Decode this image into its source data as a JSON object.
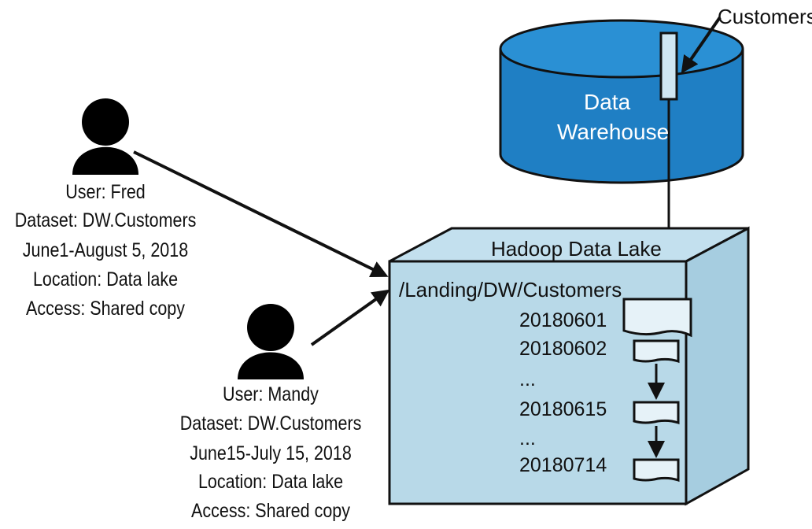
{
  "warehouse": {
    "title_line1": "Data",
    "title_line2": "Warehouse",
    "table_label": "Customers",
    "fill_color": "#1f7fc4"
  },
  "lake": {
    "title": "Hadoop Data Lake",
    "path": "/Landing/DW/Customers",
    "partitions": [
      "20180601",
      "20180602",
      "...",
      "20180615",
      "...",
      "20180714"
    ],
    "fill_color": "#b8d9e8"
  },
  "users": [
    {
      "user": "User: Fred",
      "dataset": "Dataset: DW.Customers",
      "range": "June1-August 5, 2018",
      "location": "Location: Data lake",
      "access": "Access: Shared copy"
    },
    {
      "user": "User: Mandy",
      "dataset": "Dataset: DW.Customers",
      "range": "June15-July 15, 2018",
      "location": "Location: Data lake",
      "access": "Access: Shared copy"
    }
  ]
}
